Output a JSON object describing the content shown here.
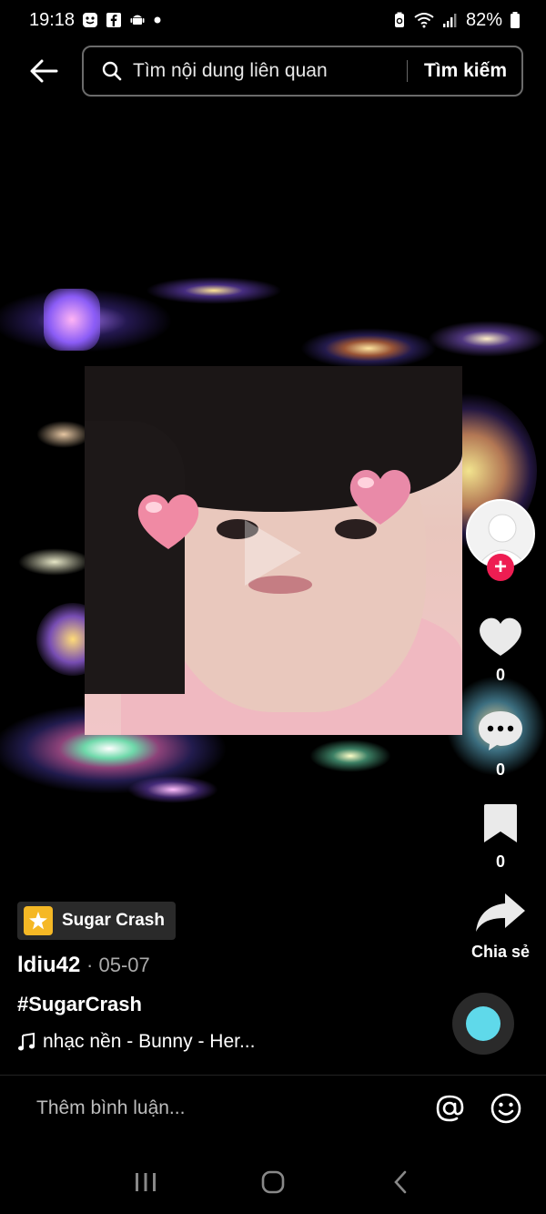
{
  "status_bar": {
    "time": "19:18",
    "battery": "82%"
  },
  "search": {
    "placeholder_text": "Tìm nội dung liên quan",
    "submit_label": "Tìm kiếm"
  },
  "video": {
    "sound_tag": "Sugar Crash",
    "username": "ldiu42",
    "date": "· 05-07",
    "hashtag": "#SugarCrash",
    "music": "nhạc nền - Bunny - Her..."
  },
  "actions": {
    "likes": "0",
    "comments": "0",
    "saves": "0",
    "share_label": "Chia sẻ"
  },
  "comment_bar": {
    "placeholder": "Thêm bình luận..."
  },
  "icons": {
    "back": "arrow-left-icon",
    "search": "search-icon",
    "like": "heart-icon",
    "comment": "comment-bubble-icon",
    "save": "bookmark-icon",
    "share": "share-arrow-icon",
    "mention": "at-icon",
    "emoji": "smiley-icon",
    "music": "music-note-icon",
    "follow": "plus-icon"
  },
  "colors": {
    "background": "#000000",
    "follow_plus": "#ee1d52",
    "disc_accent": "#5fd9ea",
    "sound_logo": "#f5b825"
  }
}
